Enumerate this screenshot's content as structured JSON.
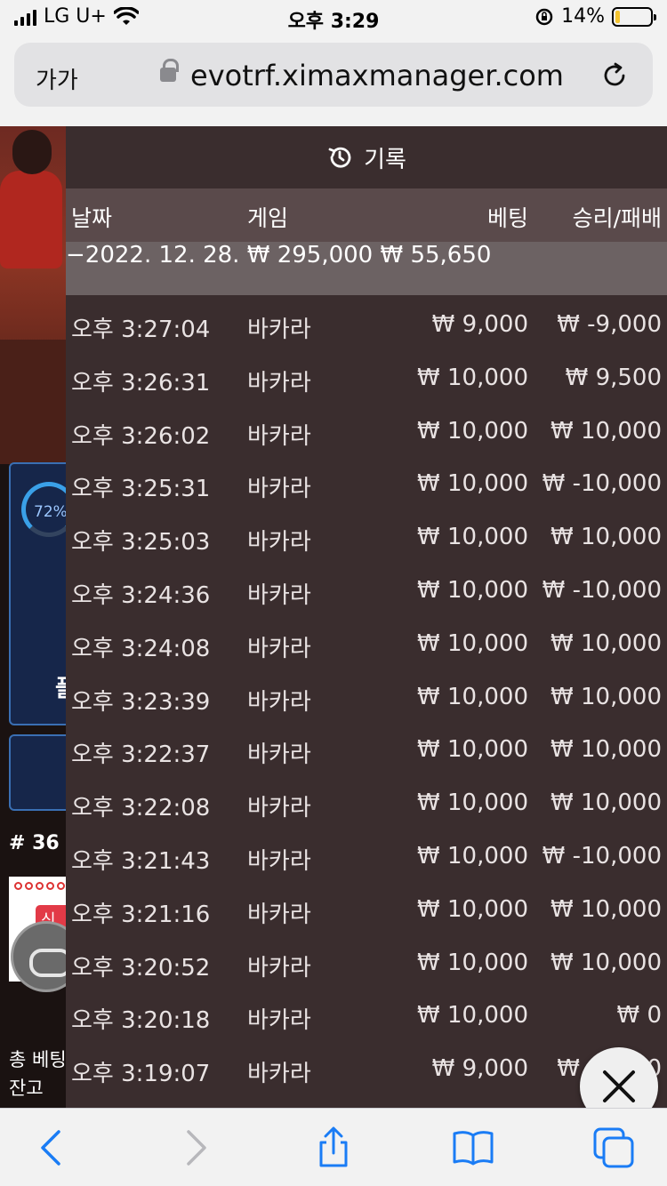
{
  "status_bar": {
    "carrier": "LG U+",
    "time": "오후 3:29",
    "battery": "14%",
    "battery_level": 0.14
  },
  "browser": {
    "text_size_button": "가가",
    "url": "evotrf.ximaxmanager.com"
  },
  "background_page": {
    "progress_label": "72%",
    "progress_value": 0.72,
    "partial_char": "플",
    "room_number": "# 36",
    "new_badge": "신구",
    "total_bet_label": "총 베팅",
    "balance_label": "잔고"
  },
  "history": {
    "title": "기록",
    "columns": {
      "date": "날짜",
      "game": "게임",
      "bet": "베팅",
      "win_loss": "승리/패배"
    },
    "summary": {
      "date": "−2022. 12. 28.",
      "bet": "₩ 295,000",
      "win_loss": "₩ 55,650"
    },
    "rows": [
      {
        "time": "오후 3:27:04",
        "game": "바카라",
        "bet": "₩ 9,000",
        "result": "₩ -9,000"
      },
      {
        "time": "오후 3:26:31",
        "game": "바카라",
        "bet": "₩ 10,000",
        "result": "₩ 9,500"
      },
      {
        "time": "오후 3:26:02",
        "game": "바카라",
        "bet": "₩ 10,000",
        "result": "₩ 10,000"
      },
      {
        "time": "오후 3:25:31",
        "game": "바카라",
        "bet": "₩ 10,000",
        "result": "₩ -10,000"
      },
      {
        "time": "오후 3:25:03",
        "game": "바카라",
        "bet": "₩ 10,000",
        "result": "₩ 10,000"
      },
      {
        "time": "오후 3:24:36",
        "game": "바카라",
        "bet": "₩ 10,000",
        "result": "₩ -10,000"
      },
      {
        "time": "오후 3:24:08",
        "game": "바카라",
        "bet": "₩ 10,000",
        "result": "₩ 10,000"
      },
      {
        "time": "오후 3:23:39",
        "game": "바카라",
        "bet": "₩ 10,000",
        "result": "₩ 10,000"
      },
      {
        "time": "오후 3:22:37",
        "game": "바카라",
        "bet": "₩ 10,000",
        "result": "₩ 10,000"
      },
      {
        "time": "오후 3:22:08",
        "game": "바카라",
        "bet": "₩ 10,000",
        "result": "₩ 10,000"
      },
      {
        "time": "오후 3:21:43",
        "game": "바카라",
        "bet": "₩ 10,000",
        "result": "₩ -10,000"
      },
      {
        "time": "오후 3:21:16",
        "game": "바카라",
        "bet": "₩ 10,000",
        "result": "₩ 10,000"
      },
      {
        "time": "오후 3:20:52",
        "game": "바카라",
        "bet": "₩ 10,000",
        "result": "₩ 10,000"
      },
      {
        "time": "오후 3:20:18",
        "game": "바카라",
        "bet": "₩ 10,000",
        "result": "₩ 0"
      },
      {
        "time": "오후 3:19:07",
        "game": "바카라",
        "bet": "₩ 9,000",
        "result": "₩ -9,000"
      }
    ]
  },
  "icons": {
    "history": "history-icon",
    "close": "close-icon",
    "back": "chevron-left-icon",
    "forward": "chevron-right-icon",
    "share": "share-icon",
    "bookmarks": "book-icon",
    "tabs": "tabs-icon",
    "reload": "reload-icon",
    "lock": "lock-icon"
  },
  "colors": {
    "panel_bg": "#3a2d2e",
    "header_row_bg": "#5a4a4b",
    "summary_bg": "#6c6263",
    "ios_blue": "#1a7cf5",
    "balance_gold": "#f1c24d"
  }
}
